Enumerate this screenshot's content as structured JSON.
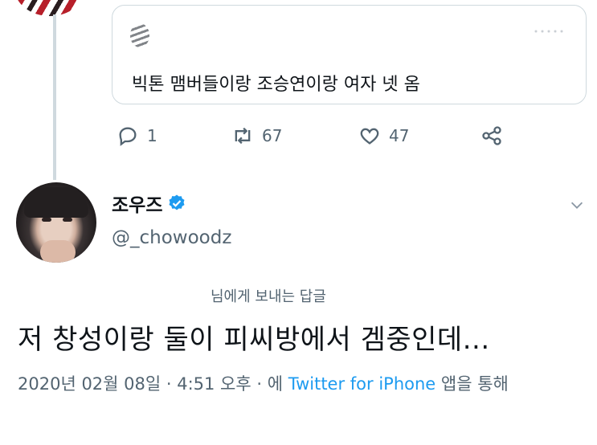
{
  "quoted_tweet": {
    "text": "빅톤 맴버들이랑 조승연이랑 여자 넷 옴",
    "reply_count": "1",
    "retweet_count": "67",
    "like_count": "47"
  },
  "author": {
    "display_name": "조우즈",
    "handle": "@_chowoodz"
  },
  "tweet": {
    "reply_to": "님에게 보내는 답글",
    "text": "저 창성이랑 둘이 피씨방에서 겜중인데...",
    "timestamp": "2020년 02월 08일 · 4:51 오후 · 에 ",
    "source": "Twitter for iPhone",
    "source_suffix": " 앱을 통해"
  },
  "colors": {
    "accent": "#1d9bf0",
    "muted": "#536471",
    "border": "#cfd9de"
  },
  "icons": [
    "reply-icon",
    "retweet-icon",
    "like-icon",
    "share-icon",
    "verified-badge-icon",
    "chevron-down-icon"
  ]
}
